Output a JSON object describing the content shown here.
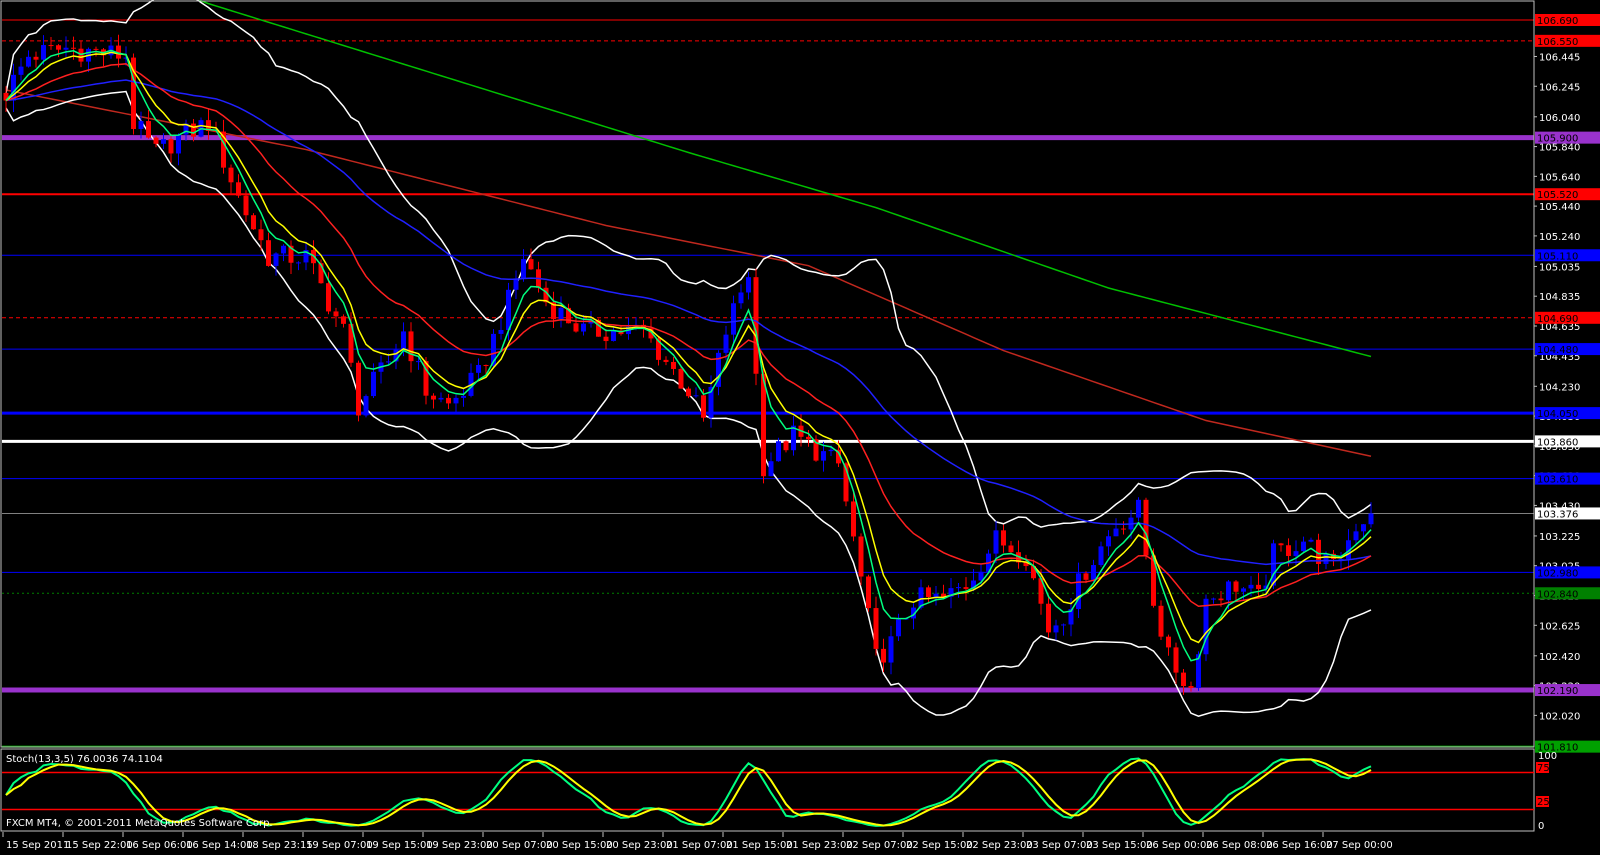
{
  "platform_label": "FXCM MT4, © 2001-2011 MetaQuotes Software Corp.",
  "stoch_label": "Stoch(13,3,5) 76.0036 74.1104",
  "stoch_levels": {
    "top": "100",
    "upper": "75",
    "lower": "25",
    "bottom": "0"
  },
  "colors": {
    "bull": "#0000ff",
    "bear": "#ff0000",
    "ema5": "#00ff7f",
    "ema8": "#ffff00",
    "ema21": "#ff2020",
    "ema55": "#2020ff",
    "bb": "#ffffff",
    "ma_long_red": "#c0281e",
    "ma_long_green": "#00c000"
  },
  "price_axis_ticks": [
    "106.445",
    "106.245",
    "106.040",
    "105.840",
    "105.640",
    "105.440",
    "105.240",
    "105.035",
    "104.835",
    "104.635",
    "104.435",
    "104.230",
    "104.030",
    "103.830",
    "103.630",
    "103.430",
    "103.225",
    "103.025",
    "102.825",
    "102.625",
    "102.420",
    "102.220",
    "102.020"
  ],
  "horizontal_lines": [
    {
      "price": "106.690",
      "color": "#ff0000",
      "style": "solid",
      "width": 1
    },
    {
      "price": "106.550",
      "color": "#ff0000",
      "style": "dashed",
      "width": 1
    },
    {
      "price": "105.900",
      "color": "#9932cc",
      "style": "solid",
      "width": 5
    },
    {
      "price": "105.520",
      "color": "#ff0000",
      "style": "solid",
      "width": 2
    },
    {
      "price": "105.110",
      "color": "#0000ff",
      "style": "solid",
      "width": 1
    },
    {
      "price": "104.690",
      "color": "#ff0000",
      "style": "dashed",
      "width": 1
    },
    {
      "price": "104.480",
      "color": "#0000ff",
      "style": "solid",
      "width": 1
    },
    {
      "price": "104.050",
      "color": "#0000ff",
      "style": "solid",
      "width": 3
    },
    {
      "price": "103.860",
      "color": "#ffffff",
      "style": "solid",
      "width": 3
    },
    {
      "price": "103.610",
      "color": "#0000ff",
      "style": "solid",
      "width": 1
    },
    {
      "price": "103.376",
      "color": "#808080",
      "style": "solid",
      "width": 1
    },
    {
      "price": "102.980",
      "color": "#0000ff",
      "style": "solid",
      "width": 1
    },
    {
      "price": "102.840",
      "color": "#008000",
      "style": "dotted",
      "width": 1
    },
    {
      "price": "102.190",
      "color": "#9932cc",
      "style": "solid",
      "width": 5
    },
    {
      "price": "101.810",
      "color": "#00a000",
      "style": "solid",
      "width": 2
    }
  ],
  "time_axis": [
    "15 Sep 2011",
    "15 Sep 22:00",
    "16 Sep 06:00",
    "16 Sep 14:00",
    "18 Sep 23:15",
    "19 Sep 07:00",
    "19 Sep 15:00",
    "19 Sep 23:00",
    "20 Sep 07:00",
    "20 Sep 15:00",
    "20 Sep 23:00",
    "21 Sep 07:00",
    "21 Sep 15:00",
    "21 Sep 23:00",
    "22 Sep 07:00",
    "22 Sep 15:00",
    "22 Sep 23:00",
    "23 Sep 07:00",
    "23 Sep 15:00",
    "26 Sep 00:00",
    "26 Sep 08:00",
    "26 Sep 16:00",
    "27 Sep 00:00"
  ],
  "chart_data": {
    "type": "candlestick",
    "bars": 183,
    "price_path": [
      [
        0,
        106.2
      ],
      [
        3,
        106.45
      ],
      [
        8,
        106.5
      ],
      [
        16,
        106.45
      ],
      [
        17,
        106.0
      ],
      [
        20,
        105.8
      ],
      [
        23,
        105.9
      ],
      [
        27,
        106.0
      ],
      [
        31,
        105.5
      ],
      [
        35,
        105.1
      ],
      [
        40,
        105.1
      ],
      [
        45,
        104.6
      ],
      [
        47,
        104.1
      ],
      [
        51,
        104.4
      ],
      [
        53,
        104.6
      ],
      [
        56,
        104.2
      ],
      [
        59,
        104.1
      ],
      [
        63,
        104.3
      ],
      [
        67,
        104.8
      ],
      [
        69,
        105.1
      ],
      [
        72,
        104.8
      ],
      [
        77,
        104.6
      ],
      [
        85,
        104.6
      ],
      [
        91,
        104.2
      ],
      [
        93,
        104.0
      ],
      [
        96,
        104.6
      ],
      [
        99,
        105.0
      ],
      [
        100,
        104.3
      ],
      [
        101,
        103.7
      ],
      [
        105,
        103.9
      ],
      [
        111,
        103.7
      ],
      [
        113,
        103.2
      ],
      [
        116,
        102.4
      ],
      [
        118,
        102.5
      ],
      [
        121,
        102.8
      ],
      [
        125,
        102.8
      ],
      [
        128,
        102.9
      ],
      [
        132,
        103.2
      ],
      [
        136,
        103.1
      ],
      [
        139,
        102.6
      ],
      [
        141,
        102.7
      ],
      [
        144,
        103.0
      ],
      [
        148,
        103.3
      ],
      [
        151,
        103.4
      ],
      [
        153,
        102.8
      ],
      [
        155,
        102.4
      ],
      [
        158,
        102.2
      ],
      [
        160,
        102.8
      ],
      [
        164,
        102.9
      ],
      [
        167,
        102.8
      ],
      [
        169,
        103.1
      ],
      [
        173,
        103.2
      ],
      [
        177,
        103.0
      ],
      [
        180,
        103.3
      ],
      [
        182,
        103.376
      ]
    ],
    "ma_long_green": [
      [
        0,
        107.3
      ],
      [
        27,
        106.8
      ],
      [
        91,
        105.8
      ],
      [
        116,
        105.43
      ],
      [
        147,
        104.89
      ],
      [
        182,
        104.43
      ]
    ],
    "ma_long_red": [
      [
        0,
        106.22
      ],
      [
        40,
        105.82
      ],
      [
        80,
        105.31
      ],
      [
        107,
        105.04
      ],
      [
        133,
        104.47
      ],
      [
        160,
        104.0
      ],
      [
        182,
        103.76
      ]
    ],
    "current_price": "103.376"
  }
}
